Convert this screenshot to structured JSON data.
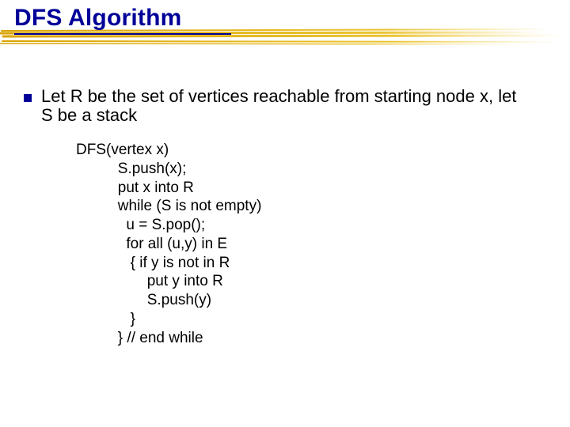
{
  "title": "DFS Algorithm",
  "bullet": "Let R be the set of vertices reachable from starting node x, let S be a stack",
  "code": "DFS(vertex x)\n          S.push(x);\n          put x into R\n          while (S is not empty)\n            u = S.pop();\n            for all (u,y) in E\n             { if y is not in R\n                 put y into R\n                 S.push(y)\n             }\n          } // end while"
}
